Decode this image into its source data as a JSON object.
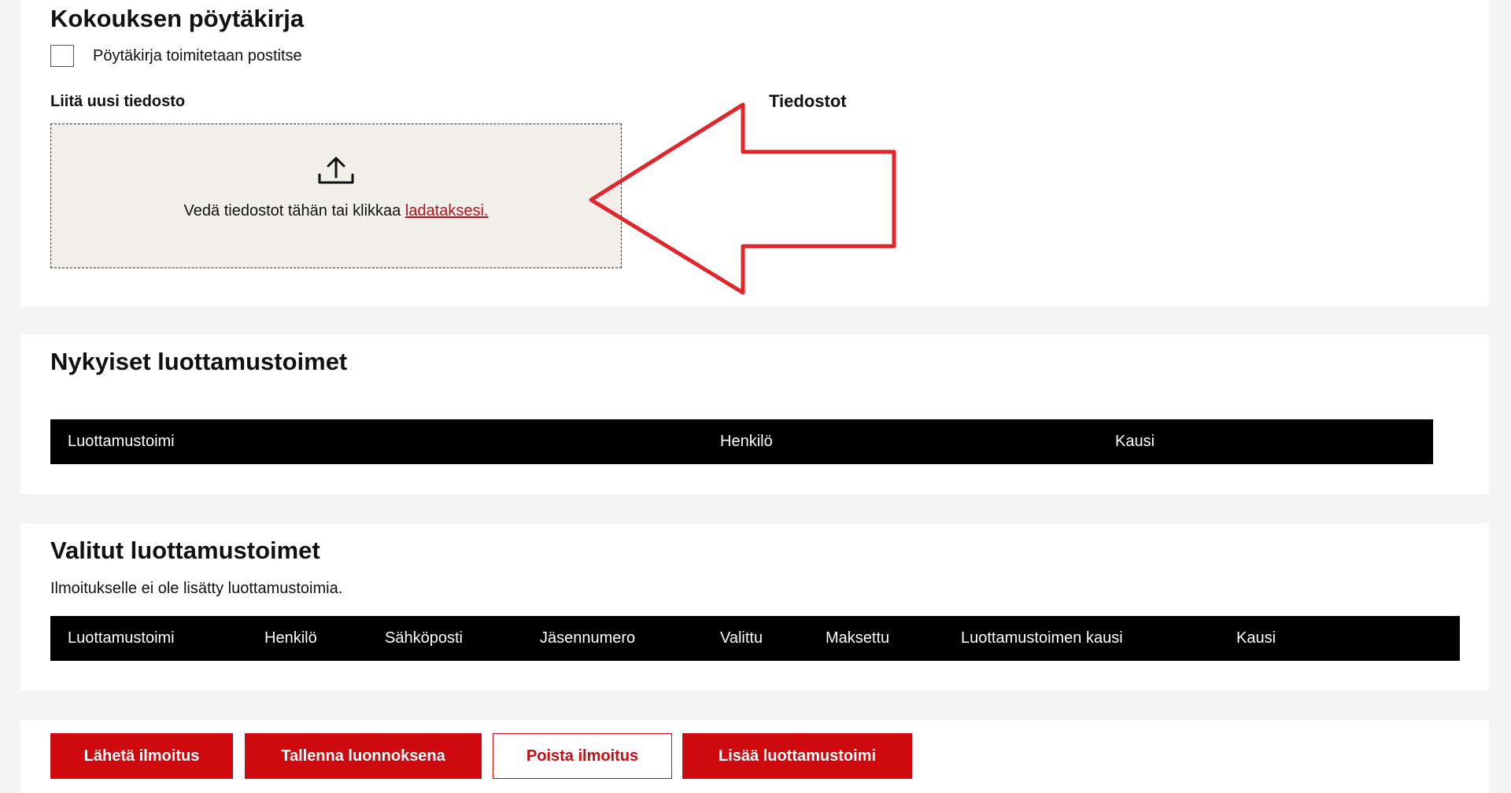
{
  "minutes": {
    "title": "Kokouksen pöytäkirja",
    "mail_checkbox_label": "Pöytäkirja toimitetaan postitse",
    "mail_checkbox_checked": false,
    "upload_label": "Liitä uusi tiedosto",
    "files_label": "Tiedostot",
    "dropzone_text": "Vedä tiedostot tähän tai klikkaa ",
    "dropzone_link": "ladataksesi.",
    "link_color": "#b5111a",
    "annotation_arrow_color": "#e3242b"
  },
  "current_positions": {
    "title": "Nykyiset luottamustoimet",
    "columns": [
      "Luottamustoimi",
      "Henkilö",
      "Kausi"
    ]
  },
  "selected_positions": {
    "title": "Valitut luottamustoimet",
    "empty_text": "Ilmoitukselle ei ole lisätty luottamustoimia.",
    "columns": [
      "Luottamustoimi",
      "Henkilö",
      "Sähköposti",
      "Jäsennumero",
      "Valittu",
      "Maksettu",
      "Luottamustoimen kausi",
      "Kausi"
    ]
  },
  "actions": {
    "send_label": "Lähetä ilmoitus",
    "save_draft_label": "Tallenna luonnoksena",
    "delete_label": "Poista ilmoitus",
    "add_position_label": "Lisää luottamustoimi",
    "brand_color": "#cf0a0f"
  }
}
